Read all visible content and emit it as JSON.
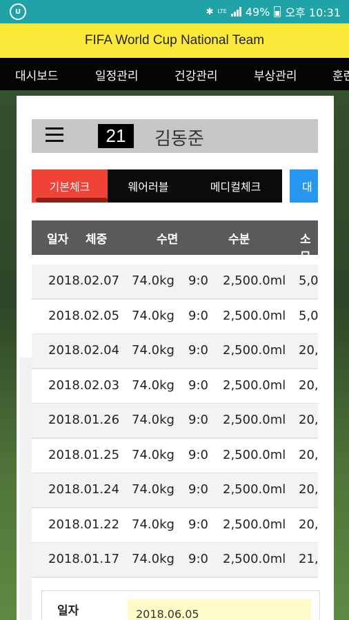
{
  "status_bar": {
    "app_icon": "app-logo-icon",
    "icons": [
      "bluetooth-icon",
      "lte-icon",
      "signal-icon",
      "battery-icon"
    ],
    "lte_label": "LTE",
    "battery": "49%",
    "time": "오후 10:31"
  },
  "title": "FIFA World Cup National Team",
  "nav": [
    "대시보드",
    "일정관리",
    "건강관리",
    "부상관리",
    "훈련"
  ],
  "player": {
    "number": "21",
    "name": "김동준"
  },
  "tabs": [
    "기본체크",
    "웨어러블",
    "메디컬체크",
    "대"
  ],
  "table": {
    "headers": [
      "일자",
      "체중",
      "수면",
      "수분",
      "소모"
    ],
    "rows": [
      [
        "2018.02.07",
        "74.0kg",
        "9:0",
        "2,500.0ml",
        "5,0"
      ],
      [
        "2018.02.05",
        "74.0kg",
        "9:0",
        "2,500.0ml",
        "5,0"
      ],
      [
        "2018.02.04",
        "74.0kg",
        "9:0",
        "2,500.0ml",
        "20,"
      ],
      [
        "2018.02.03",
        "74.0kg",
        "9:0",
        "2,500.0ml",
        "20,"
      ],
      [
        "2018.01.26",
        "74.0kg",
        "9:0",
        "2,500.0ml",
        "20,"
      ],
      [
        "2018.01.25",
        "74.0kg",
        "9:0",
        "2,500.0ml",
        "20,"
      ],
      [
        "2018.01.24",
        "74.0kg",
        "9:0",
        "2,500.0ml",
        "20,"
      ],
      [
        "2018.01.22",
        "74.0kg",
        "9:0",
        "2,500.0ml",
        "20,"
      ],
      [
        "2018.01.17",
        "74.0kg",
        "9:0",
        "2,500.0ml",
        "21,"
      ]
    ]
  },
  "detail": {
    "label": "일자",
    "value": "2018.06.05"
  },
  "colors": {
    "status_bar": "#1fa3a6",
    "title_bar": "#fbea3a",
    "active_tab": "#ee4336",
    "blue_tab": "#2696ee",
    "table_header": "#5a5a5a"
  }
}
